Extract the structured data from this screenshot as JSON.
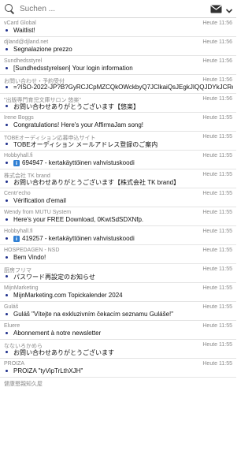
{
  "search": {
    "placeholder": "Suchen ..."
  },
  "messages": [
    {
      "sender": "vCard Global",
      "time": "Heute 11:56",
      "subject": "Waitlist!",
      "info": false
    },
    {
      "sender": "djland@djland.net",
      "time": "Heute 11:56",
      "subject": "Segnalazione prezzo",
      "info": false
    },
    {
      "sender": "Sundhedsstyrel",
      "time": "Heute 11:56",
      "subject": "[Sundhedsstyrelsen] Your login information",
      "info": false
    },
    {
      "sender": "お問い合わせ・予約受付",
      "time": "Heute 11:56",
      "subject": "=?ISO-2022-JP?B?GyRCJCpMZCQkOWckbyQ7JClkaiQsJEgkJIQQJDYkJCReJ...",
      "info": false
    },
    {
      "sender": "\"出版専門育児文庫サロン 悠楽\"",
      "time": "Heute 11:56",
      "subject": "お問い合わせありがとうございます【悠楽】",
      "info": false
    },
    {
      "sender": "Irene Boggs",
      "time": "Heute 11:55",
      "subject": "Congratulations! Here's your AffirmaJam song!",
      "info": false
    },
    {
      "sender": "TOBEオーディション応募申込サイト",
      "time": "Heute 11:55",
      "subject": "TOBEオーディション メールアドレス登録のご案内",
      "info": false
    },
    {
      "sender": "Hobbyhall.fi",
      "time": "Heute 11:55",
      "subject": "694947 - kertakäyttöinen vahvistuskoodi",
      "info": true
    },
    {
      "sender": "株式会社 TK brand",
      "time": "Heute 11:55",
      "subject": "お問い合わせありがとうございます【株式会社 TK brand】",
      "info": false
    },
    {
      "sender": "Centr'echo",
      "time": "Heute 11:55",
      "subject": "Vérification d'email",
      "info": false
    },
    {
      "sender": "Wendy from MUTU System",
      "time": "Heute 11:55",
      "subject": "Here's your FREE Download, 0KwtSdSDXNfp.",
      "info": false
    },
    {
      "sender": "Hobbyhall.fi",
      "time": "Heute 11:55",
      "subject": "419257 - kertakäyttöinen vahvistuskoodi",
      "info": true
    },
    {
      "sender": "HOSPEDAGEN - NSD",
      "time": "Heute 11:55",
      "subject": "Bem Vindo!",
      "info": false
    },
    {
      "sender": "厨房フリマ",
      "time": "Heute 11:55",
      "subject": "パスワード再設定のお知らせ",
      "info": false
    },
    {
      "sender": "MijnMarketing",
      "time": "Heute 11:55",
      "subject": "MijnMarketing.com Topickalender 2024",
      "info": false
    },
    {
      "sender": "Guláš",
      "time": "Heute 11:55",
      "subject": "Guláš \"Vítejte na exkluzivním čekacím seznamu Guláše!\"",
      "info": false
    },
    {
      "sender": "Eluere",
      "time": "Heute 11:55",
      "subject": "Abonnement à notre newsletter",
      "info": false
    },
    {
      "sender": "なないろかめら",
      "time": "Heute 11:55",
      "subject": "お問い合わせありがとうございます",
      "info": false
    },
    {
      "sender": "PROIZA",
      "time": "Heute 11:55",
      "subject": "PROIZA \"tyVipTrLthXJH\"",
      "info": false
    }
  ],
  "partial_sender": "健康懇親知久屋"
}
